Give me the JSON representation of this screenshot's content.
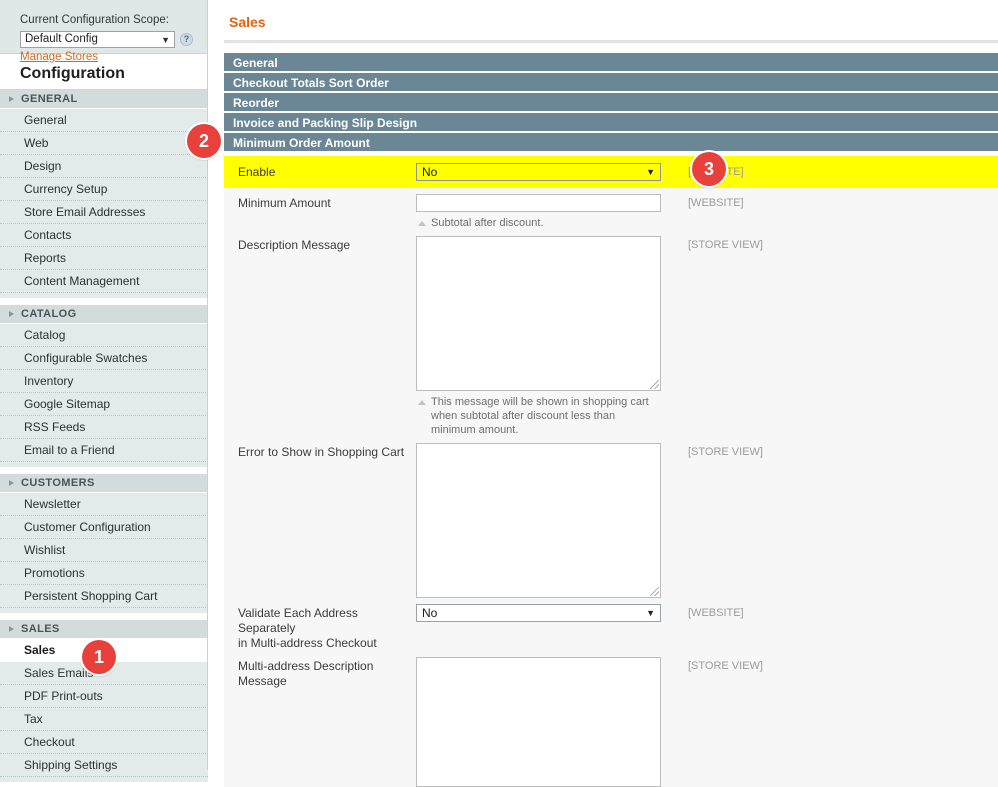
{
  "scope": {
    "label": "Current Configuration Scope:",
    "value": "Default Config",
    "caret": "▼",
    "help_icon": "?",
    "manage_stores_link": "Manage Stores"
  },
  "sidebar": {
    "title": "Configuration",
    "groups": [
      {
        "name": "GENERAL",
        "items": [
          {
            "label": "General",
            "active": false
          },
          {
            "label": "Web",
            "active": false
          },
          {
            "label": "Design",
            "active": false
          },
          {
            "label": "Currency Setup",
            "active": false
          },
          {
            "label": "Store Email Addresses",
            "active": false
          },
          {
            "label": "Contacts",
            "active": false
          },
          {
            "label": "Reports",
            "active": false
          },
          {
            "label": "Content Management",
            "active": false
          }
        ]
      },
      {
        "name": "CATALOG",
        "items": [
          {
            "label": "Catalog",
            "active": false
          },
          {
            "label": "Configurable Swatches",
            "active": false
          },
          {
            "label": "Inventory",
            "active": false
          },
          {
            "label": "Google Sitemap",
            "active": false
          },
          {
            "label": "RSS Feeds",
            "active": false
          },
          {
            "label": "Email to a Friend",
            "active": false
          }
        ]
      },
      {
        "name": "CUSTOMERS",
        "items": [
          {
            "label": "Newsletter",
            "active": false
          },
          {
            "label": "Customer Configuration",
            "active": false
          },
          {
            "label": "Wishlist",
            "active": false
          },
          {
            "label": "Promotions",
            "active": false
          },
          {
            "label": "Persistent Shopping Cart",
            "active": false
          }
        ]
      },
      {
        "name": "SALES",
        "items": [
          {
            "label": "Sales",
            "active": true
          },
          {
            "label": "Sales Emails",
            "active": false
          },
          {
            "label": "PDF Print-outs",
            "active": false
          },
          {
            "label": "Tax",
            "active": false
          },
          {
            "label": "Checkout",
            "active": false
          },
          {
            "label": "Shipping Settings",
            "active": false
          }
        ]
      }
    ]
  },
  "main": {
    "page_title": "Sales",
    "sections": [
      {
        "label": "General"
      },
      {
        "label": "Checkout Totals Sort Order"
      },
      {
        "label": "Reorder"
      },
      {
        "label": "Invoice and Packing Slip Design"
      },
      {
        "label": "Minimum Order Amount"
      }
    ],
    "fields": {
      "enable": {
        "label": "Enable",
        "value": "No",
        "scope": "[WEBSITE]",
        "caret": "▼"
      },
      "minimum_amount": {
        "label": "Minimum Amount",
        "value": "",
        "scope": "[WEBSITE]",
        "hint": "Subtotal after discount."
      },
      "description_message": {
        "label": "Description Message",
        "value": "",
        "scope": "[STORE VIEW]",
        "hint_line1": "This message will be shown in shopping cart when",
        "hint_line2": "subtotal after discount less than minimum amount."
      },
      "error_message": {
        "label": "Error to Show in Shopping Cart",
        "value": "",
        "scope": "[STORE VIEW]"
      },
      "validate_each_address": {
        "label_line1": "Validate Each Address Separately",
        "label_line2": "in Multi-address Checkout",
        "value": "No",
        "scope": "[WEBSITE]",
        "caret": "▼"
      },
      "multi_address_description": {
        "label_line1": "Multi-address Description",
        "label_line2": "Message",
        "value": "",
        "scope": "[STORE VIEW]"
      }
    }
  },
  "badges": {
    "one": "1",
    "two": "2",
    "three": "3"
  },
  "colors": {
    "accent_orange": "#e8600a",
    "section_bar": "#6b8694",
    "badge_red": "#e8403a",
    "highlight_yellow": "#ffff00",
    "link_orange": "#d2691e"
  }
}
